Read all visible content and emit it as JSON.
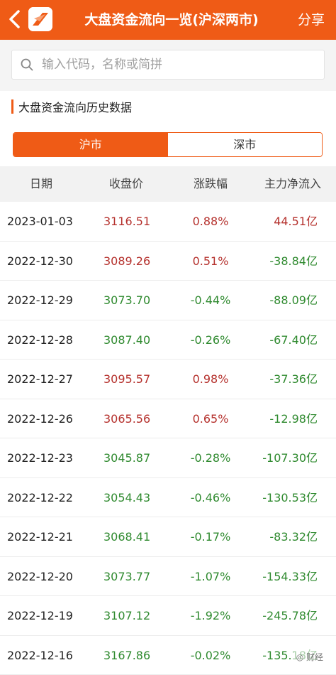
{
  "header": {
    "title": "大盘资金流向一览(沪深两市)",
    "share_label": "分享",
    "back_icon": "chevron-left-icon",
    "app_icon": "app-logo-icon",
    "accent_color": "#ef5b16"
  },
  "search": {
    "placeholder": "输入代码，名称或简拼",
    "value": ""
  },
  "section": {
    "title": "大盘资金流向历史数据"
  },
  "tabs": [
    {
      "label": "沪市",
      "active": true
    },
    {
      "label": "深市",
      "active": false
    }
  ],
  "table": {
    "columns": [
      "日期",
      "收盘价",
      "涨跌幅",
      "主力净流入"
    ],
    "rows": [
      {
        "date": "2023-01-03",
        "price": "3116.51",
        "pct": "0.88%",
        "flow": "44.51亿",
        "up": true,
        "flow_up": true
      },
      {
        "date": "2022-12-30",
        "price": "3089.26",
        "pct": "0.51%",
        "flow": "-38.84亿",
        "up": true,
        "flow_up": false
      },
      {
        "date": "2022-12-29",
        "price": "3073.70",
        "pct": "-0.44%",
        "flow": "-88.09亿",
        "up": false,
        "flow_up": false
      },
      {
        "date": "2022-12-28",
        "price": "3087.40",
        "pct": "-0.26%",
        "flow": "-67.40亿",
        "up": false,
        "flow_up": false
      },
      {
        "date": "2022-12-27",
        "price": "3095.57",
        "pct": "0.98%",
        "flow": "-37.36亿",
        "up": true,
        "flow_up": false
      },
      {
        "date": "2022-12-26",
        "price": "3065.56",
        "pct": "0.65%",
        "flow": "-12.98亿",
        "up": true,
        "flow_up": false
      },
      {
        "date": "2022-12-23",
        "price": "3045.87",
        "pct": "-0.28%",
        "flow": "-107.30亿",
        "up": false,
        "flow_up": false
      },
      {
        "date": "2022-12-22",
        "price": "3054.43",
        "pct": "-0.46%",
        "flow": "-130.53亿",
        "up": false,
        "flow_up": false
      },
      {
        "date": "2022-12-21",
        "price": "3068.41",
        "pct": "-0.17%",
        "flow": "-83.32亿",
        "up": false,
        "flow_up": false
      },
      {
        "date": "2022-12-20",
        "price": "3073.77",
        "pct": "-1.07%",
        "flow": "-154.33亿",
        "up": false,
        "flow_up": false
      },
      {
        "date": "2022-12-19",
        "price": "3107.12",
        "pct": "-1.92%",
        "flow": "-245.78亿",
        "up": false,
        "flow_up": false
      },
      {
        "date": "2022-12-16",
        "price": "3167.86",
        "pct": "-0.02%",
        "flow": "-135.18亿",
        "up": false,
        "flow_up": false
      }
    ]
  },
  "colors": {
    "up": "#b5312d",
    "down": "#2f8a2f"
  }
}
